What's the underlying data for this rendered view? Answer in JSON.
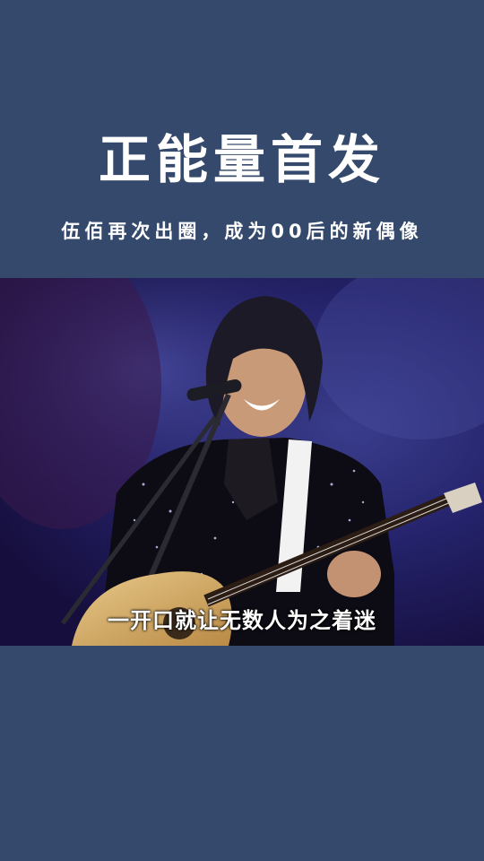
{
  "header": {
    "title": "正能量首发",
    "subtitle": "伍佰再次出圈，成为00后的新偶像"
  },
  "video": {
    "caption": "一开口就让无数人为之着迷"
  },
  "colors": {
    "background": "#34496b",
    "text": "#ffffff",
    "stage": "#24226a"
  }
}
